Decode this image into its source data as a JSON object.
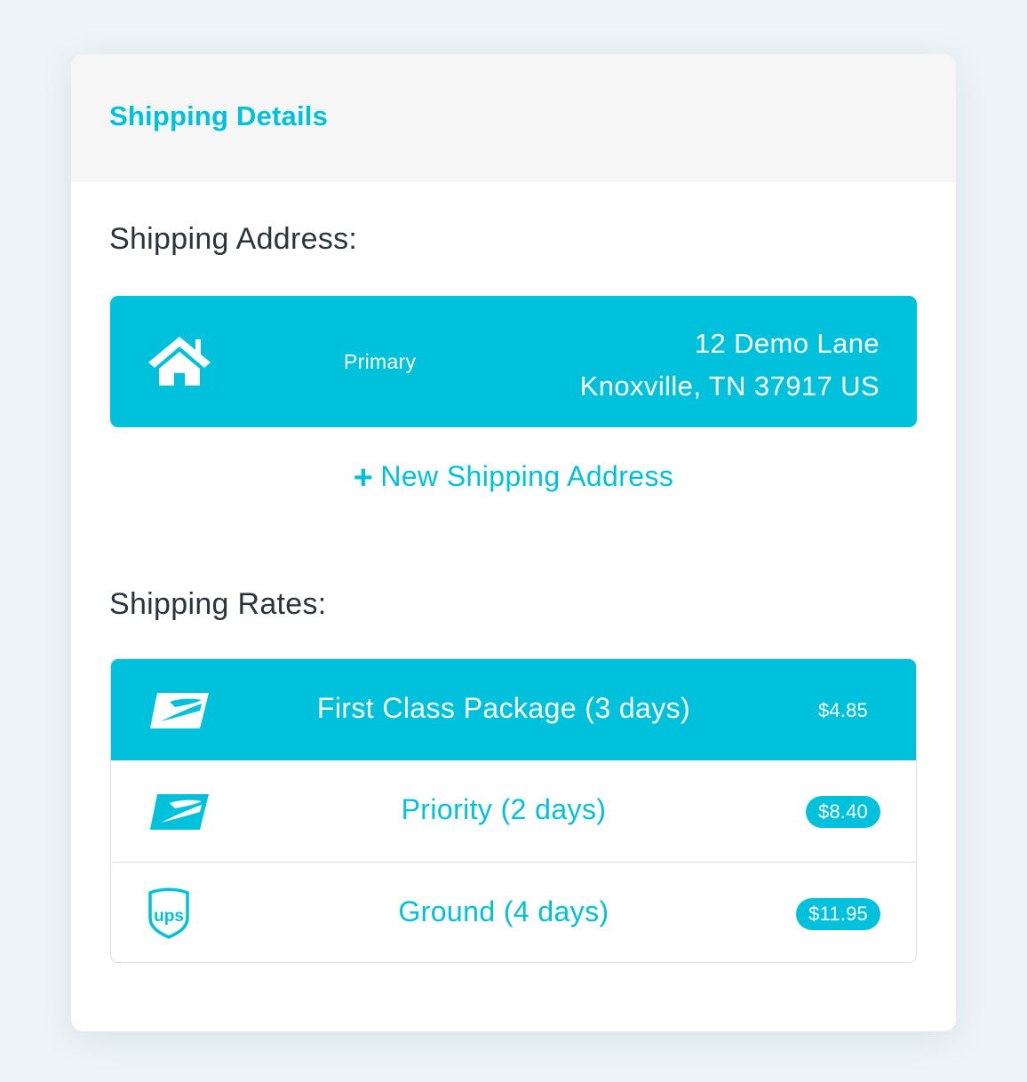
{
  "card": {
    "title": "Shipping Details"
  },
  "address_section": {
    "label": "Shipping Address:",
    "address": {
      "icon": "home-icon",
      "tag": "Primary",
      "line1": "12 Demo Lane",
      "line2": "Knoxville, TN 37917 US"
    },
    "new_address_label": "New Shipping Address"
  },
  "rates_section": {
    "label": "Shipping Rates:",
    "rates": [
      {
        "carrier": "usps-logo",
        "name": "First Class Package (3 days)",
        "price": "$4.85",
        "selected": true
      },
      {
        "carrier": "usps-logo",
        "name": "Priority (2 days)",
        "price": "$8.40",
        "selected": false
      },
      {
        "carrier": "ups-logo",
        "name": "Ground (4 days)",
        "price": "$11.95",
        "selected": false
      }
    ]
  },
  "colors": {
    "accent": "#00c1dc",
    "header_bg": "#f6f6f6",
    "page_bg": "#edf4f7",
    "text_dark": "#2a343a"
  }
}
